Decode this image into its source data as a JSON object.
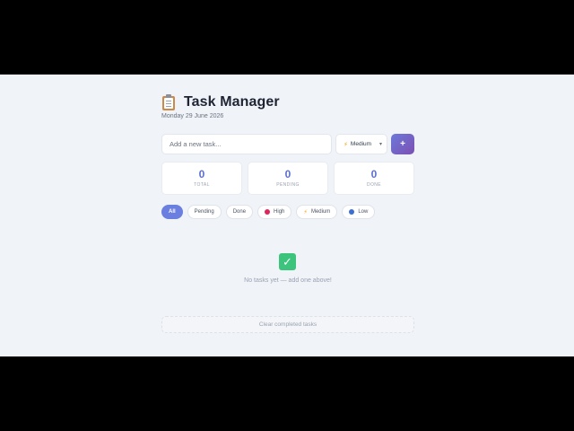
{
  "header": {
    "title": "Task Manager",
    "date": "Monday 29 June 2026",
    "icon": "clipboard-icon"
  },
  "add_task": {
    "placeholder": "Add a new task...",
    "priority_value": "Medium",
    "add_label": "+"
  },
  "stats": [
    {
      "value": "0",
      "label": "TOTAL"
    },
    {
      "value": "0",
      "label": "PENDING"
    },
    {
      "value": "0",
      "label": "DONE"
    }
  ],
  "filters": {
    "all": "All",
    "pending": "Pending",
    "done": "Done",
    "high": "High",
    "medium": "Medium",
    "low": "Low"
  },
  "empty": {
    "icon": "check-icon",
    "text": "No tasks yet — add one above!"
  },
  "footer": {
    "clear_label": "Clear completed tasks"
  },
  "colors": {
    "accent": "#6b7fe0",
    "high": "#e0245e",
    "low": "#3b6fd1",
    "medium": "#f59e0b",
    "success": "#3cc47c"
  }
}
